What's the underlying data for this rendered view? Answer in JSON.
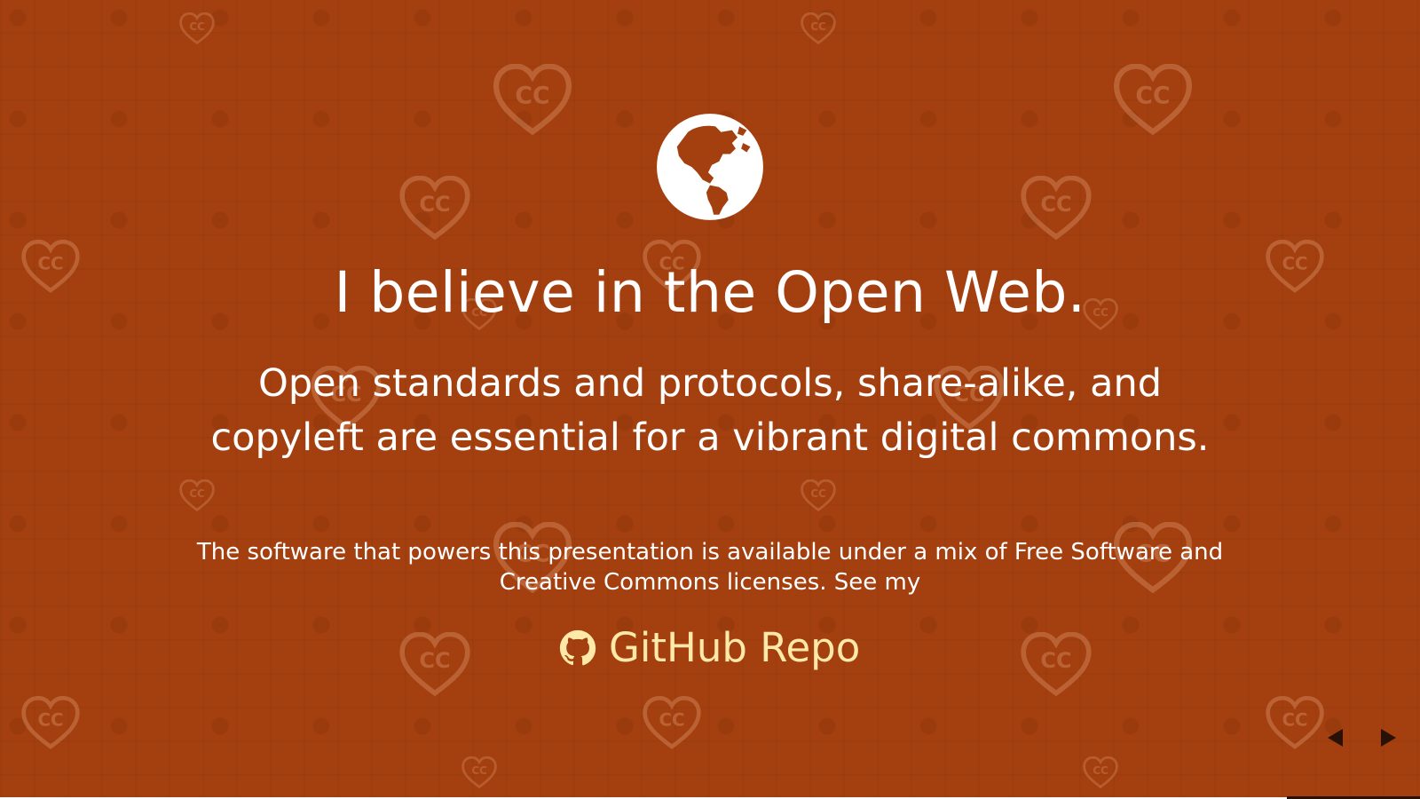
{
  "slide": {
    "background_color": "#a43f0f",
    "icon": "globe-americas-icon",
    "title": "I believe in the Open Web.",
    "subtitle": "Open standards and protocols, share-alike, and copyleft are essential for a vibrant digital commons.",
    "footnote": "The software that powers this presentation is available under a mix of Free Software and Creative Commons licenses. See my",
    "repo_link": {
      "icon": "github-icon",
      "label": "GitHub Repo",
      "color": "#ffe9a8"
    },
    "watermark": {
      "icon": "cc-heart-icon",
      "label": "CC"
    }
  },
  "navigation": {
    "prev_icon": "triangle-left-icon",
    "next_icon": "triangle-right-icon"
  }
}
